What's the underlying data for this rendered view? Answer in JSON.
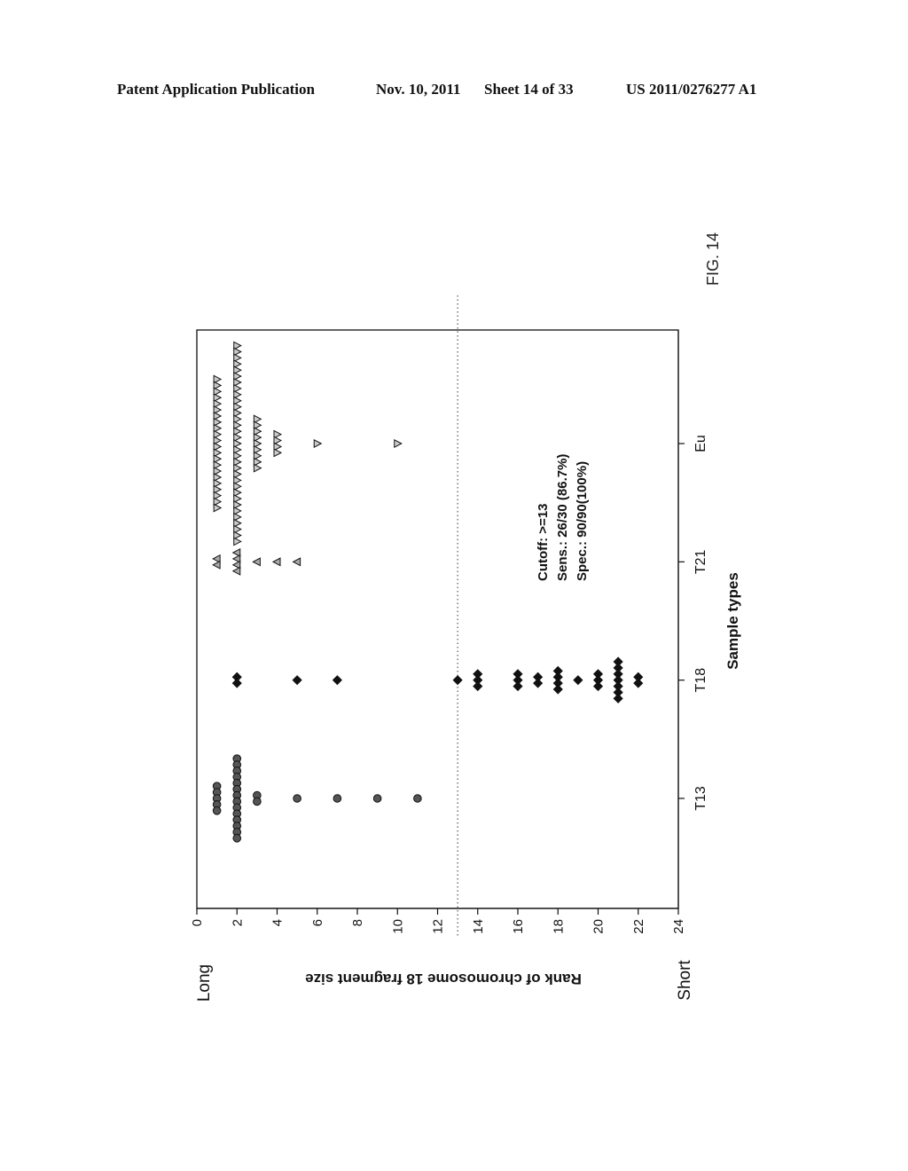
{
  "header": {
    "publication": "Patent Application Publication",
    "date": "Nov. 10, 2011",
    "sheet": "Sheet 14 of 33",
    "number": "US 2011/0276277 A1"
  },
  "figure_label": "FIG. 14",
  "chart_data": {
    "type": "scatter",
    "subtype": "dot-strip (beeswarm)",
    "orientation": "figure rotated 90 degrees on page",
    "xlabel": "Sample types",
    "ylabel": "Rank of chromosome 18 fragment size",
    "y_end_labels": {
      "low": "Long",
      "high": "Short"
    },
    "categories": [
      "T13",
      "T18",
      "T21",
      "Eu"
    ],
    "ylim": [
      0,
      24
    ],
    "yticks": [
      0,
      2,
      4,
      6,
      8,
      10,
      12,
      14,
      16,
      18,
      20,
      22,
      24
    ],
    "grid": false,
    "cutoff_line": {
      "value": 13,
      "style": "dotted"
    },
    "annotation": [
      "Cutoff: >=13",
      "Sens.: 26/30 (86.7%)",
      "Spec.: 90/90(100%)"
    ],
    "series": [
      {
        "name": "T13",
        "marker": "circle",
        "color": "#555555",
        "values": [
          {
            "rank": 1,
            "count": 5
          },
          {
            "rank": 2,
            "count": 14
          },
          {
            "rank": 3,
            "count": 2
          },
          {
            "rank": 5,
            "count": 1
          },
          {
            "rank": 7,
            "count": 1
          },
          {
            "rank": 9,
            "count": 1
          },
          {
            "rank": 11,
            "count": 1
          }
        ]
      },
      {
        "name": "T18",
        "marker": "diamond",
        "color": "#111111",
        "values": [
          {
            "rank": 2,
            "count": 2
          },
          {
            "rank": 5,
            "count": 1
          },
          {
            "rank": 7,
            "count": 1
          },
          {
            "rank": 13,
            "count": 1
          },
          {
            "rank": 14,
            "count": 3
          },
          {
            "rank": 16,
            "count": 3
          },
          {
            "rank": 17,
            "count": 2
          },
          {
            "rank": 18,
            "count": 4
          },
          {
            "rank": 19,
            "count": 1
          },
          {
            "rank": 20,
            "count": 3
          },
          {
            "rank": 21,
            "count": 7
          },
          {
            "rank": 22,
            "count": 2
          }
        ]
      },
      {
        "name": "T21",
        "marker": "triangle-up",
        "color": "#aaaaaa",
        "values": [
          {
            "rank": 1,
            "count": 2
          },
          {
            "rank": 2,
            "count": 4
          },
          {
            "rank": 3,
            "count": 1
          },
          {
            "rank": 4,
            "count": 1
          },
          {
            "rank": 5,
            "count": 1
          }
        ]
      },
      {
        "name": "Eu",
        "marker": "triangle-down",
        "color": "#cccccc",
        "values": [
          {
            "rank": 1,
            "count": 22
          },
          {
            "rank": 2,
            "count": 33
          },
          {
            "rank": 3,
            "count": 9
          },
          {
            "rank": 4,
            "count": 4
          },
          {
            "rank": 6,
            "count": 1
          },
          {
            "rank": 10,
            "count": 1
          }
        ]
      }
    ]
  }
}
